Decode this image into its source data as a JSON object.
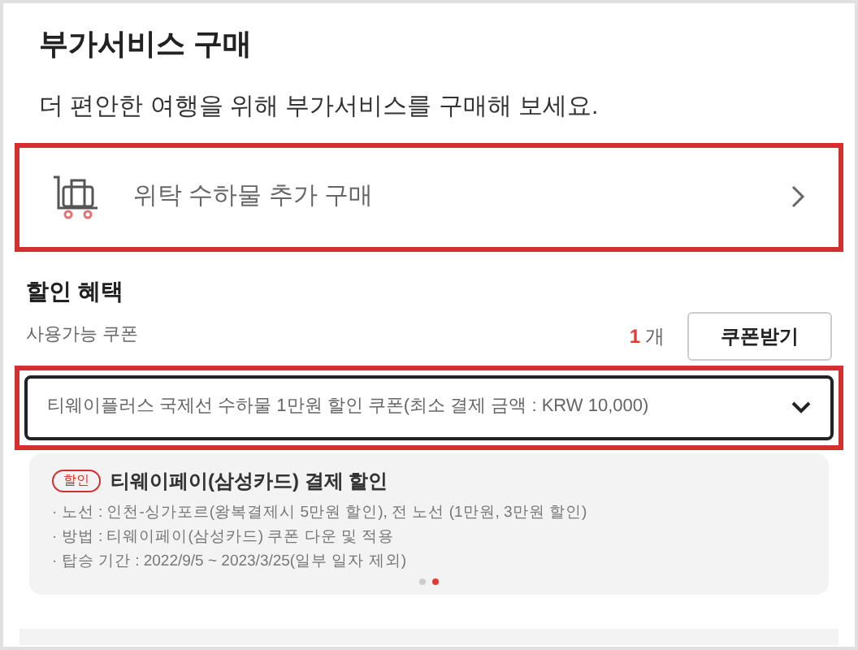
{
  "title": "부가서비스 구매",
  "subtitle": "더 편안한 여행을 위해 부가서비스를 구매해 보세요.",
  "service_item": {
    "label": "위탁 수하물 추가 구매",
    "highlighted": true
  },
  "discount": {
    "heading": "할인 혜택",
    "coupon_label": "사용가능 쿠폰",
    "coupon_count": "1",
    "count_unit": "개",
    "get_coupon_button": "쿠폰받기",
    "coupon_select": {
      "value": "티웨이플러스 국제선 수하물 1만원 할인 쿠폰(최소 결제 금액 : KRW 10,000)",
      "highlighted": true
    }
  },
  "promo_card": {
    "badge": "할인",
    "title": "티웨이페이(삼성카드) 결제 할인",
    "lines": [
      "· 노선 : 인천-싱가포르(왕복결제시 5만원 할인), 전 노선 (1만원, 3만원 할인)",
      "· 방법 : 티웨이페이(삼성카드) 쿠폰 다운 및 적용",
      "· 탑승 기간 : 2022/9/5 ~ 2023/3/25(일부 일자 제외)"
    ],
    "pages": [
      {
        "selected": false
      },
      {
        "selected": true
      }
    ]
  }
}
